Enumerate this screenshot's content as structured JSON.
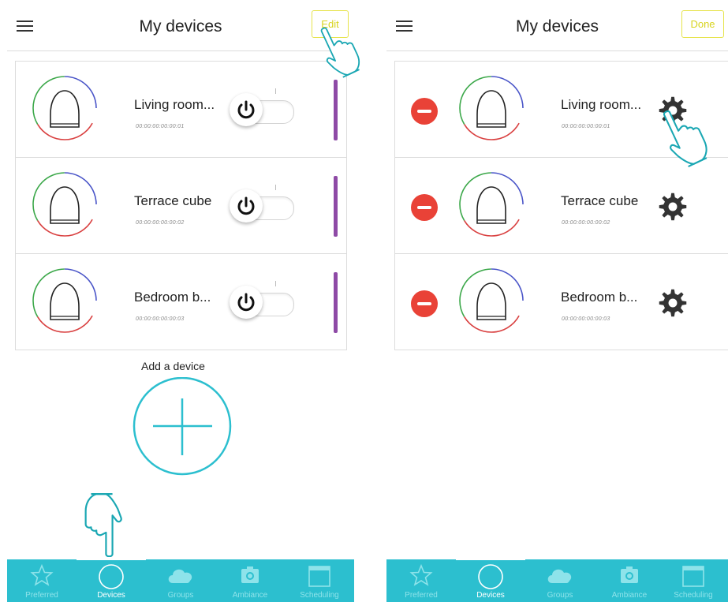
{
  "colors": {
    "accent": "#2cbfcf",
    "edit_border": "#e6e34a",
    "delete_red": "#e94237",
    "device_bar": "#8e4aa6"
  },
  "left": {
    "header": {
      "title": "My devices",
      "edit_label": "Edit"
    },
    "devices": [
      {
        "name": "Living room...",
        "mac": "00:00:00:00:00:01"
      },
      {
        "name": "Terrace cube",
        "mac": "00:00:00:00:00:02"
      },
      {
        "name": "Bedroom b...",
        "mac": "00:00:00:00:00:03"
      }
    ],
    "add_device_label": "Add a device",
    "nav": [
      {
        "label": "Preferred",
        "icon": "star-icon"
      },
      {
        "label": "Devices",
        "icon": "circle-icon"
      },
      {
        "label": "Groups",
        "icon": "cloud-icon"
      },
      {
        "label": "Ambiance",
        "icon": "camera-icon"
      },
      {
        "label": "Scheduling",
        "icon": "calendar-icon"
      }
    ]
  },
  "right": {
    "header": {
      "title": "My devices",
      "done_label": "Done"
    },
    "devices": [
      {
        "name": "Living room...",
        "mac": "00:00:00:00:00:01"
      },
      {
        "name": "Terrace cube",
        "mac": "00:00:00:00:00:02"
      },
      {
        "name": "Bedroom b...",
        "mac": "00:00:00:00:00:03"
      }
    ],
    "nav": [
      {
        "label": "Preferred",
        "icon": "star-icon"
      },
      {
        "label": "Devices",
        "icon": "circle-icon"
      },
      {
        "label": "Groups",
        "icon": "cloud-icon"
      },
      {
        "label": "Ambiance",
        "icon": "camera-icon"
      },
      {
        "label": "Scheduling",
        "icon": "calendar-icon"
      }
    ]
  }
}
